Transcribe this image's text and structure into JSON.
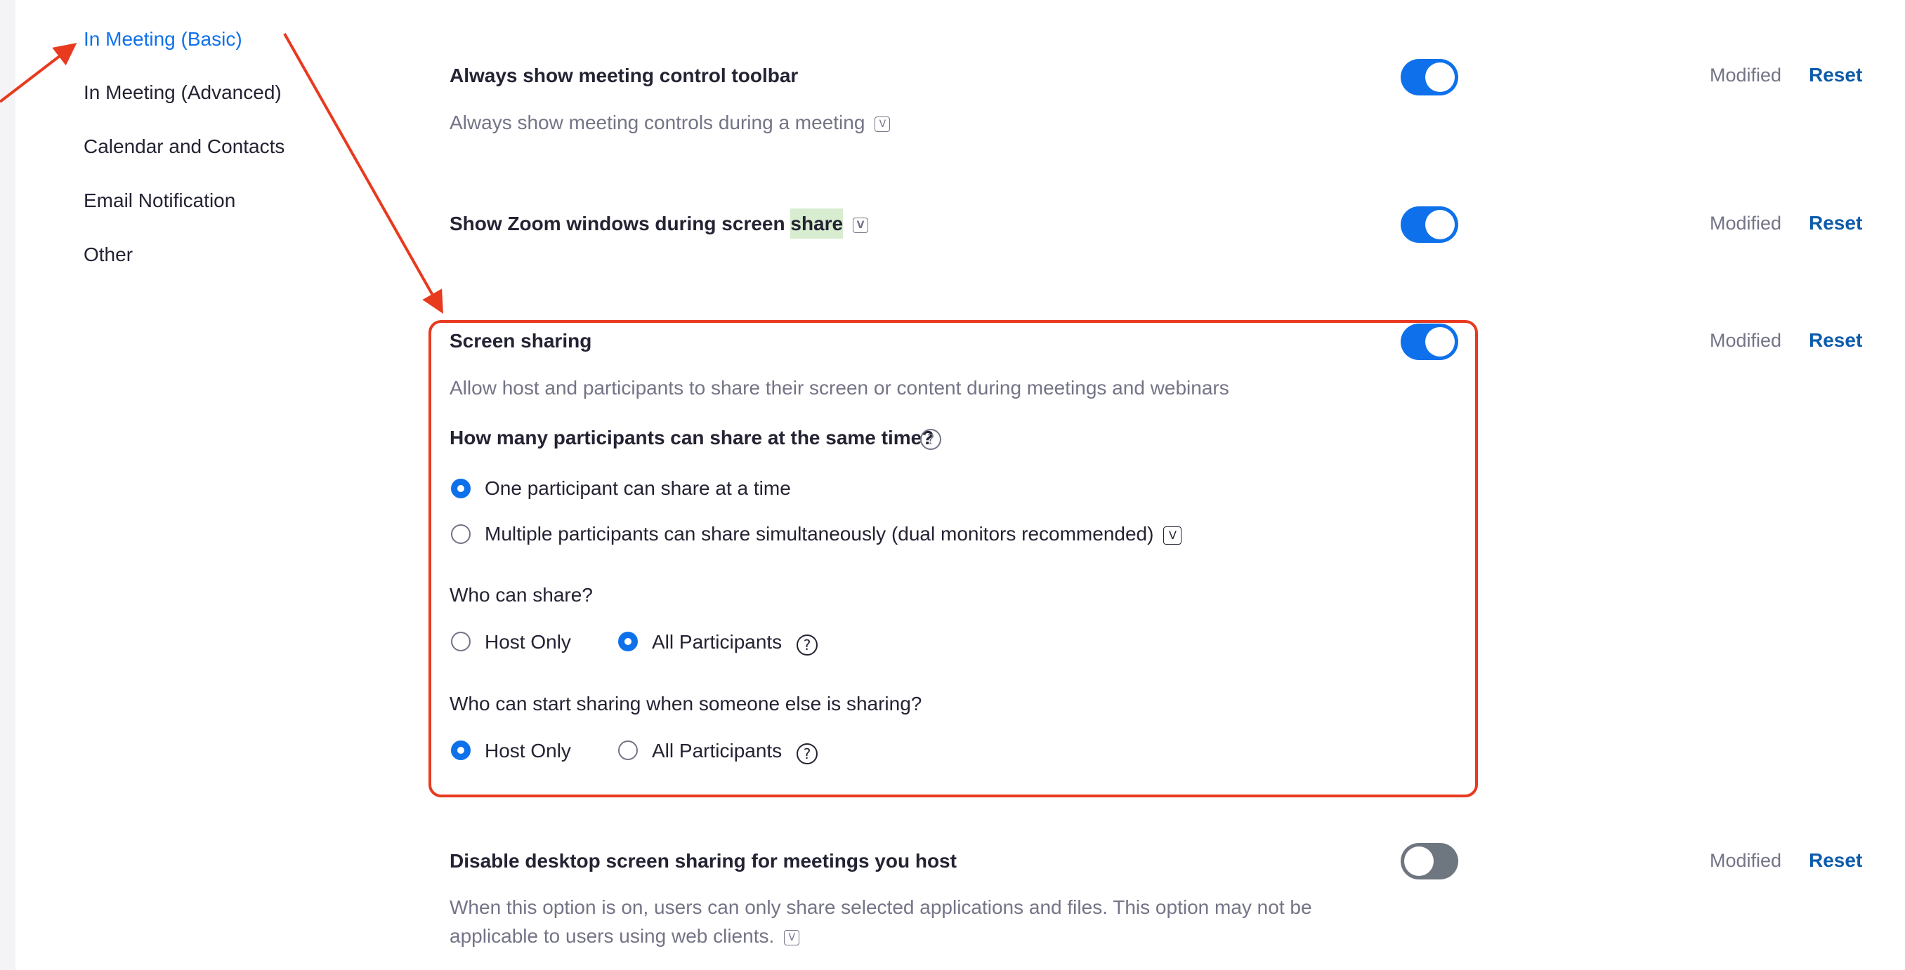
{
  "sidebar": {
    "items": [
      {
        "label": "In Meeting (Basic)",
        "active": true
      },
      {
        "label": "In Meeting (Advanced)"
      },
      {
        "label": "Calendar and Contacts"
      },
      {
        "label": "Email Notification"
      },
      {
        "label": "Other"
      }
    ]
  },
  "settings": {
    "toolbar": {
      "title": "Always show meeting control toolbar",
      "description": "Always show meeting controls during a meeting",
      "enabled": true,
      "status": "Modified",
      "reset": "Reset"
    },
    "zoom_windows": {
      "title_before": "Show Zoom windows during screen ",
      "title_highlight": "share",
      "enabled": true,
      "status": "Modified",
      "reset": "Reset"
    },
    "screen_sharing": {
      "title": "Screen sharing",
      "description": "Allow host and participants to share their screen or content during meetings and webinars",
      "enabled": true,
      "status": "Modified",
      "reset": "Reset",
      "q1": "How many participants can share at the same time?",
      "q1_opt1": "One participant can share at a time",
      "q1_opt2": "Multiple participants can share simultaneously (dual monitors recommended)",
      "q2": "Who can share?",
      "q2_opt1": "Host Only",
      "q2_opt2": "All Participants",
      "q3": "Who can start sharing when someone else is sharing?",
      "q3_opt1": "Host Only",
      "q3_opt2": "All Participants"
    },
    "disable_desktop": {
      "title": "Disable desktop screen sharing for meetings you host",
      "description_line1": "When this option is on, users can only share selected applications and files. This option may not be",
      "description_line2": "applicable to users using web clients.",
      "enabled": false,
      "status": "Modified",
      "reset": "Reset"
    }
  },
  "colors": {
    "accent": "#0e71eb",
    "reset_link": "#0e5baa",
    "annotation": "#e83a1f",
    "toggle_off": "#6e7680",
    "muted_text": "#747487"
  },
  "icons": {
    "info": "info-box-icon",
    "help": "question-circle-icon",
    "arrow": "annotation-arrow"
  }
}
